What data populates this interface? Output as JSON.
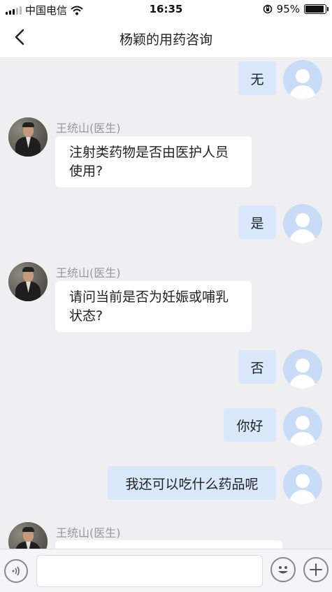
{
  "status_bar": {
    "carrier": "中国电信",
    "time": "16:35",
    "battery": "95%"
  },
  "nav": {
    "title": "杨颖的用药咨询"
  },
  "doctor": {
    "name": "王统山(医生)"
  },
  "messages": [
    {
      "side": "right",
      "text": "无"
    },
    {
      "side": "left",
      "text": "注射类药物是否由医护人员使用?"
    },
    {
      "side": "right",
      "text": "是"
    },
    {
      "side": "left",
      "text": "请问当前是否为妊娠或哺乳状态?"
    },
    {
      "side": "right",
      "text": "否"
    },
    {
      "side": "right",
      "text": "你好"
    },
    {
      "side": "right",
      "text": "我还可以吃什么药品呢"
    },
    {
      "side": "left",
      "text": ""
    }
  ],
  "input": {
    "value": "",
    "placeholder": ""
  },
  "icons": {
    "voice": "voice-icon",
    "emoji": "emoji-icon",
    "add": "plus-icon",
    "back": "chevron-left-icon",
    "wifi": "wifi-icon",
    "lock": "orientation-lock-icon"
  },
  "colors": {
    "user_bubble": "#d9e8fb",
    "doctor_bubble": "#ffffff",
    "background": "#efeef0"
  }
}
